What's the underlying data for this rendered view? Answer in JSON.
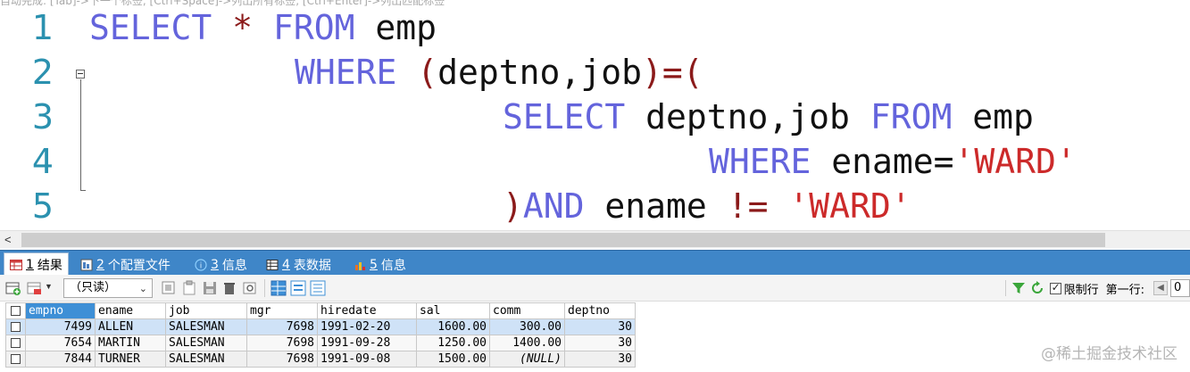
{
  "editor": {
    "hint": "自动完成: [Tab]->下一个标签, [Ctrl+Space]->列出所有标签, [Ctrl+Enter]->列出匹配标签",
    "line_numbers": [
      "1",
      "2",
      "3",
      "4",
      "5"
    ],
    "lines": [
      [
        {
          "t": "SELECT",
          "c": "kw"
        },
        {
          "t": " ",
          "c": "id"
        },
        {
          "t": "*",
          "c": "op"
        },
        {
          "t": " ",
          "c": "id"
        },
        {
          "t": "FROM",
          "c": "kw"
        },
        {
          "t": " emp",
          "c": "id"
        }
      ],
      [
        {
          "t": "WHERE",
          "c": "kw"
        },
        {
          "t": " ",
          "c": "id"
        },
        {
          "t": "(",
          "c": "op"
        },
        {
          "t": "deptno,job",
          "c": "id"
        },
        {
          "t": ")=(",
          "c": "op"
        }
      ],
      [
        {
          "t": "SELECT",
          "c": "kw"
        },
        {
          "t": " deptno,job ",
          "c": "id"
        },
        {
          "t": "FROM",
          "c": "kw"
        },
        {
          "t": " emp",
          "c": "id"
        }
      ],
      [
        {
          "t": "WHERE",
          "c": "kw"
        },
        {
          "t": " ename=",
          "c": "id"
        },
        {
          "t": "'WARD'",
          "c": "str"
        }
      ],
      [
        {
          "t": ")",
          "c": "op"
        },
        {
          "t": "AND",
          "c": "kw"
        },
        {
          "t": " ename ",
          "c": "id"
        },
        {
          "t": "!=",
          "c": "op"
        },
        {
          "t": " ",
          "c": "id"
        },
        {
          "t": "'WARD'",
          "c": "str"
        }
      ]
    ]
  },
  "tabs": [
    {
      "num": "1",
      "label": "结果",
      "active": true,
      "icon": "table-icon"
    },
    {
      "num": "2",
      "label": "个配置文件",
      "active": false,
      "icon": "profile-icon"
    },
    {
      "num": "3",
      "label": "信息",
      "active": false,
      "icon": "info-icon"
    },
    {
      "num": "4",
      "label": "表数据",
      "active": false,
      "icon": "table-data-icon"
    },
    {
      "num": "5",
      "label": "信息",
      "active": false,
      "icon": "info-chart-icon"
    }
  ],
  "toolbar": {
    "readonly_label": "（只读）",
    "limit_rows_label": "限制行",
    "first_row_label": "第一行:",
    "first_row_value": "0"
  },
  "grid": {
    "columns": [
      "empno",
      "ename",
      "job",
      "mgr",
      "hiredate",
      "sal",
      "comm",
      "deptno"
    ],
    "rows": [
      [
        "7499",
        "ALLEN",
        "SALESMAN",
        "7698",
        "1991-02-20",
        "1600.00",
        "300.00",
        "30"
      ],
      [
        "7654",
        "MARTIN",
        "SALESMAN",
        "7698",
        "1991-09-28",
        "1250.00",
        "1400.00",
        "30"
      ],
      [
        "7844",
        "TURNER",
        "SALESMAN",
        "7698",
        "1991-09-08",
        "1500.00",
        "(NULL)",
        "30"
      ]
    ]
  },
  "watermark": "@稀土掘金技术社区"
}
